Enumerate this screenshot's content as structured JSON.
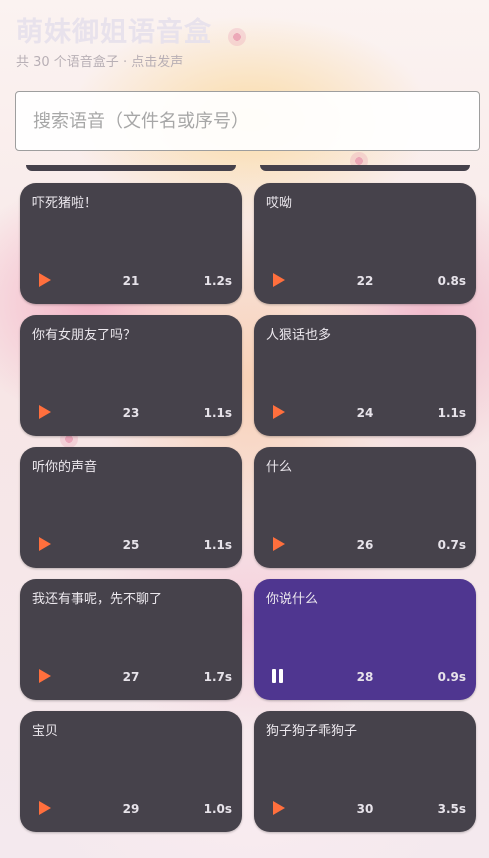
{
  "app": {
    "title": "萌妹御姐语音盒",
    "subtitle": "共 30 个语音盒子 · 点击发声"
  },
  "search": {
    "placeholder": "搜索语音（文件名或序号）",
    "value": ""
  },
  "colors": {
    "card": "#46424b",
    "card_active": "#4f3690",
    "play_icon": "#ff6f3d"
  },
  "clips": [
    {
      "name": "吓死猪啦！",
      "num": "21",
      "duration": "1.2s",
      "state": "play-icon"
    },
    {
      "name": "哎呦",
      "num": "22",
      "duration": "0.8s",
      "state": "play-icon"
    },
    {
      "name": "你有女朋友了吗？",
      "num": "23",
      "duration": "1.1s",
      "state": "play-icon"
    },
    {
      "name": "人狠话也多",
      "num": "24",
      "duration": "1.1s",
      "state": "play-icon"
    },
    {
      "name": "听你的声音",
      "num": "25",
      "duration": "1.1s",
      "state": "play-icon"
    },
    {
      "name": "什么",
      "num": "26",
      "duration": "0.7s",
      "state": "play-icon"
    },
    {
      "name": "我还有事呢，先不聊了",
      "num": "27",
      "duration": "1.7s",
      "state": "play-icon"
    },
    {
      "name": "你说什么",
      "num": "28",
      "duration": "0.9s",
      "state": "pause-icon"
    },
    {
      "name": "宝贝",
      "num": "29",
      "duration": "1.0s",
      "state": "play-icon"
    },
    {
      "name": "狗子狗子乖狗子",
      "num": "30",
      "duration": "3.5s",
      "state": "play-icon"
    }
  ]
}
